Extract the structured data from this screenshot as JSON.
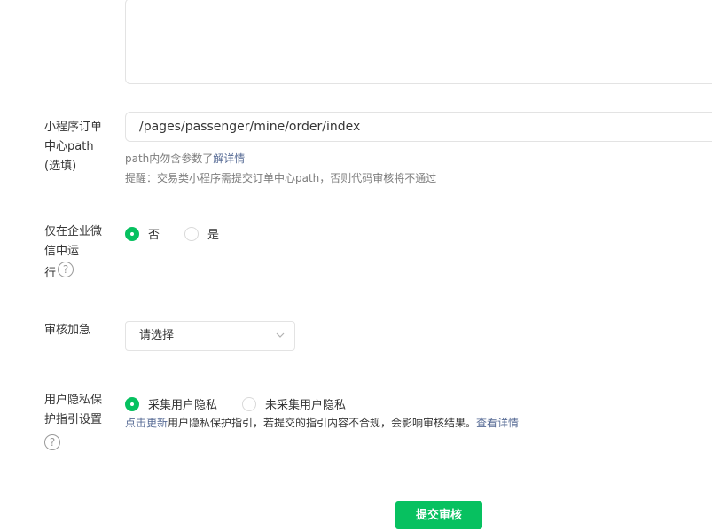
{
  "orderPath": {
    "label_lines": [
      "小程序订单",
      "中心path",
      "(选填)"
    ],
    "value": "/pages/passenger/mine/order/index",
    "hint_prefix": "path内勿含参数了",
    "hint_link": "解详情",
    "reminder": "提醒：交易类小程序需提交订单中心path，否则代码审核将不通过"
  },
  "enterpriseOnly": {
    "label_lines": [
      "仅在企业微",
      "信中运",
      "行"
    ],
    "help_icon": "?",
    "options": [
      {
        "label": "否",
        "checked": true
      },
      {
        "label": "是",
        "checked": false
      }
    ]
  },
  "urgent": {
    "label": "审核加急",
    "select_value": "请选择"
  },
  "privacy": {
    "label_lines": [
      "用户隐私保",
      "护指引设置"
    ],
    "help_icon": "?",
    "options": [
      {
        "label": "采集用户隐私",
        "checked": true
      },
      {
        "label": "未采集用户隐私",
        "checked": false
      }
    ],
    "update_link": "点击更新",
    "desc": "用户隐私保护指引，若提交的指引内容不合规，会影响审核结果。",
    "detail_link": "查看详情"
  },
  "submit_label": "提交审核",
  "colors": {
    "accent": "#07c160",
    "link": "#576b95"
  }
}
